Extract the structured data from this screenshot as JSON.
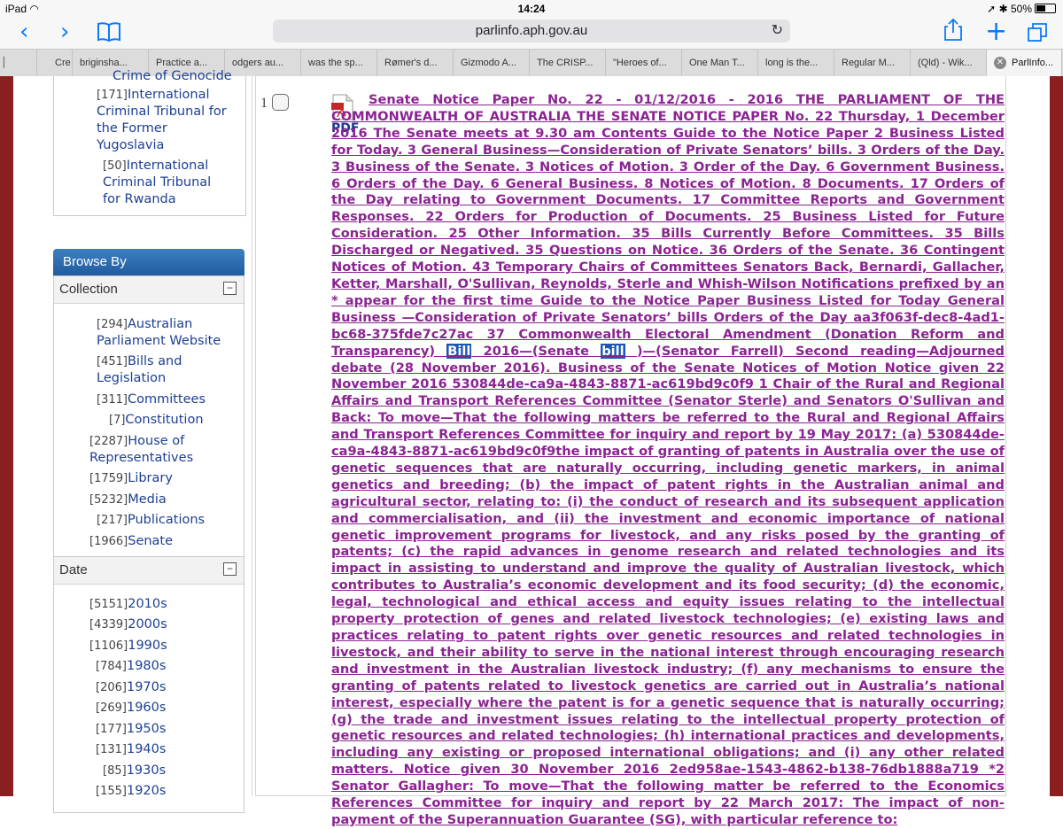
{
  "status": {
    "device": "iPad",
    "time": "14:24",
    "battery": "50%"
  },
  "browser": {
    "url": "parlinfo.aph.gov.au",
    "tabs": [
      "Cre",
      "briginsha...",
      "Practice a...",
      "odgers au...",
      "was the sp...",
      "Rømer's d...",
      "Gizmodo A...",
      "The CRISP...",
      "\"Heroes of...",
      "One Man T...",
      "long is the...",
      "Regular M...",
      "(Qld) - Wik...",
      "ParlInfo..."
    ]
  },
  "sidebar": {
    "top_items": [
      {
        "label": "Crime of Genocide"
      },
      {
        "count": "[171]",
        "label": "International Criminal Tribunal for the Former Yugoslavia"
      },
      {
        "count": "[50]",
        "label": "International Criminal Tribunal for Rwanda"
      }
    ],
    "browse_by": "Browse By",
    "collection": {
      "title": "Collection",
      "items": [
        {
          "count": "[294]",
          "label": "Australian Parliament Website"
        },
        {
          "count": "[451]",
          "label": "Bills and Legislation"
        },
        {
          "count": "[311]",
          "label": "Committees"
        },
        {
          "count": "[7]",
          "label": "Constitution"
        },
        {
          "count": "[2287]",
          "label": "House of Representatives"
        },
        {
          "count": "[1759]",
          "label": "Library"
        },
        {
          "count": "[5232]",
          "label": "Media"
        },
        {
          "count": "[217]",
          "label": "Publications"
        },
        {
          "count": "[1966]",
          "label": "Senate"
        }
      ]
    },
    "date": {
      "title": "Date",
      "items": [
        {
          "count": "[5151]",
          "label": "2010s"
        },
        {
          "count": "[4339]",
          "label": "2000s"
        },
        {
          "count": "[1106]",
          "label": "1990s"
        },
        {
          "count": "[784]",
          "label": "1980s"
        },
        {
          "count": "[206]",
          "label": "1970s"
        },
        {
          "count": "[269]",
          "label": "1960s"
        },
        {
          "count": "[177]",
          "label": "1950s"
        },
        {
          "count": "[131]",
          "label": "1940s"
        },
        {
          "count": "[85]",
          "label": "1930s"
        },
        {
          "count": "[155]",
          "label": "1920s"
        }
      ]
    }
  },
  "result": {
    "number": "1",
    "pdf_label": "PDF",
    "text_before": "Senate Notice Paper No. 22 - 01/12/2016 - 2016 THE PARLIAMENT OF THE COMMONWEALTH OF AUSTRALIA THE SENATE NOTICE PAPER No. 22 Thursday, 1 December 2016 The Senate meets at 9.30 am Contents Guide to the Notice Paper 2 Business Listed for Today. 3 General Business—Consideration of Private Senators’ bills. 3 Orders of the Day. 3 Business of the Senate. 3 Notices of Motion. 3 Order of the Day. 6 Government Business. 6 Orders of the Day. 6 General Business. 8 Notices of Motion. 8 Documents. 17 Orders of the Day relating to Government Documents. 17 Committee Reports and Government Responses. 22 Orders for Production of Documents. 25 Business Listed for Future Consideration. 25 Other Information. 35 Bills Currently Before Committees. 35 Bills Discharged or Negatived. 35 Questions on Notice. 36 Orders of the Senate. 36 Contingent Notices of Motion. 43 Temporary Chairs of Committees Senators Back, Bernardi, Gallacher, Ketter, Marshall, O'Sullivan, Reynolds, Sterle and Whish-Wilson Notifications prefixed by an * appear for the first time Guide to the Notice Paper Business Listed for Today General Business —Consideration of Private Senators’ bills Orders of the Day aa3f063f-dec8-4ad1-bc68-375fde7c27ac 37 Commonwealth Electoral Amendment (Donation Reform and Transparency) ",
    "hl1": "Bill",
    "text_mid": " 2016—(Senate ",
    "hl2": "bill",
    "text_after": " )—(Senator Farrell) Second reading—Adjourned debate (28 November 2016). Business of the Senate Notices of Motion Notice given 22 November 2016 530844de-ca9a-4843-8871-ac619bd9c0f9 1 Chair of the Rural and Regional Affairs and Transport References Committee (Senator Sterle) and Senators O'Sullivan and Back: To move—That the following matters be referred to the Rural and Regional Affairs and Transport References Committee for inquiry and report by 19 May 2017: (a) 530844de-ca9a-4843-8871-ac619bd9c0f9the impact of granting of patents in Australia over the use of genetic sequences that are naturally occurring, including genetic markers, in animal genetics and breeding; (b) the impact of patent rights in the Australian animal and agricultural sector, relating to: (i) the conduct of research and its subsequent application and commercialisation, and (ii) the investment and economic importance of national genetic improvement programs for livestock, and any risks posed by the granting of patents; (c) the rapid advances in genome research and related technologies and its impact in assisting to understand and improve the quality of Australian livestock, which contributes to Australia’s economic development and its food security; (d) the economic, legal, technological and ethical access and equity issues relating to the intellectual property protection of genes and related livestock technologies; (e) existing laws and practices relating to patent rights over genetic resources and related technologies in livestock, and their ability to serve in the national interest through encouraging research and investment in the Australian livestock industry; (f) any mechanisms to ensure the granting of patents related to livestock genetics are carried out in Australia’s national interest, especially where the patent is for a genetic sequence that is naturally occurring; (g) the trade and investment issues relating to the intellectual property protection of genetic resources and related technologies; (h) international practices and developments, including any existing or proposed international obligations; and (i) any other related matters. Notice given 30 November 2016 2ed958ae-1543-4862-b138-76db1888a719 *2 Senator Gallagher: To move—That the following matter be referred to the Economics References Committee for inquiry and report by 22 March 2017: The impact of non-payment of the Superannuation Guarantee (SG), with particular reference to:"
  },
  "colors": {
    "link": "#1c3f94",
    "visited": "#8a2491",
    "frame": "#8b1e1e",
    "browse_head": "#2a6db2",
    "ios_blue": "#0a7aff"
  }
}
